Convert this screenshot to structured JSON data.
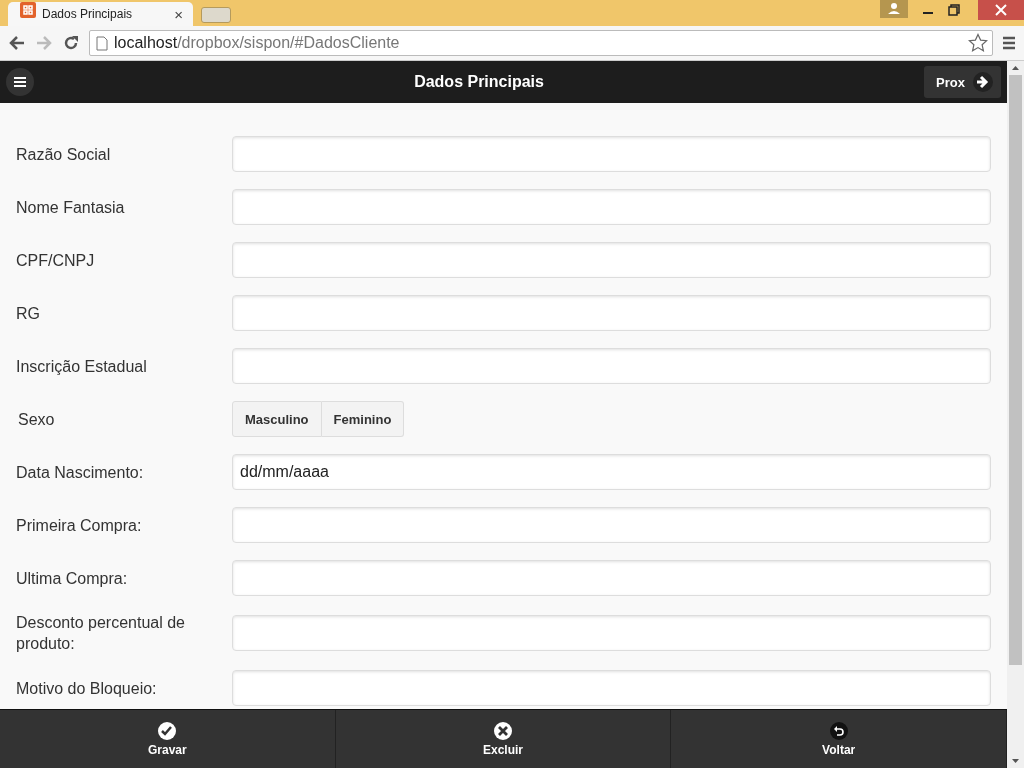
{
  "browser": {
    "tab_title": "Dados Principais",
    "tab_close": "×",
    "address": {
      "host": "localhost",
      "path": "/dropbox/sispon/#DadosCliente"
    }
  },
  "header": {
    "title": "Dados Principais",
    "next_button": "Prox"
  },
  "form": [
    {
      "kind": "text",
      "label": "Razão Social"
    },
    {
      "kind": "text",
      "label": "Nome Fantasia"
    },
    {
      "kind": "text",
      "label": "CPF/CNPJ"
    },
    {
      "kind": "text",
      "label": "RG"
    },
    {
      "kind": "text",
      "label": "Inscrição Estadual"
    },
    {
      "kind": "choice",
      "label": "Sexo",
      "options": [
        {
          "label": "Masculino",
          "selected": false
        },
        {
          "label": "Feminino",
          "selected": false
        }
      ]
    },
    {
      "kind": "text",
      "label": "Data Nascimento:",
      "value": "dd/mm/aaaa"
    },
    {
      "kind": "text",
      "label": "Primeira Compra:"
    },
    {
      "kind": "text",
      "label": "Ultima Compra:"
    },
    {
      "kind": "text",
      "label": "Desconto percentual de produto:"
    },
    {
      "kind": "text",
      "label": "Motivo do Bloqueio:"
    }
  ],
  "footer": [
    {
      "kind": "check",
      "label": "Gravar"
    },
    {
      "kind": "delete",
      "label": "Excluir"
    },
    {
      "kind": "back",
      "label": "Voltar"
    }
  ]
}
